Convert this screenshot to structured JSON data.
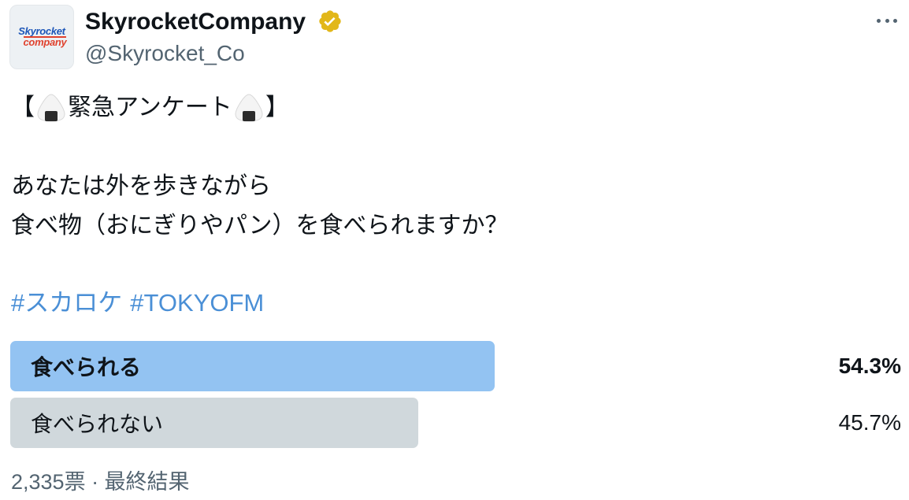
{
  "author": {
    "display_name": "SkyrocketCompany",
    "handle": "@Skyrocket_Co",
    "verified": true,
    "badge_color": "#e2b719",
    "avatar_logo_line1": "Skyrocket",
    "avatar_logo_line2": "company"
  },
  "more_icon": "more-horizontal-icon",
  "tweet": {
    "line1_open": "【",
    "line1_title": "緊急アンケート",
    "line1_close": "】",
    "line1_icon": "onigiri-icon",
    "line2": "あなたは外を歩きながら",
    "line3": "食べ物（おにぎりやパン）を食べられますか？",
    "hashtags": [
      "#スカロケ",
      "#TOKYOFM"
    ],
    "link_color": "#4a8fd6"
  },
  "poll": {
    "options": [
      {
        "label": "食べられる",
        "percent_text": "54.3%",
        "percent": 54.3,
        "winner": true,
        "color": "#93c3f2"
      },
      {
        "label": "食べられない",
        "percent_text": "45.7%",
        "percent": 45.7,
        "winner": false,
        "color": "#d0d8dc"
      }
    ],
    "footer": "2,335票 · 最終結果"
  }
}
